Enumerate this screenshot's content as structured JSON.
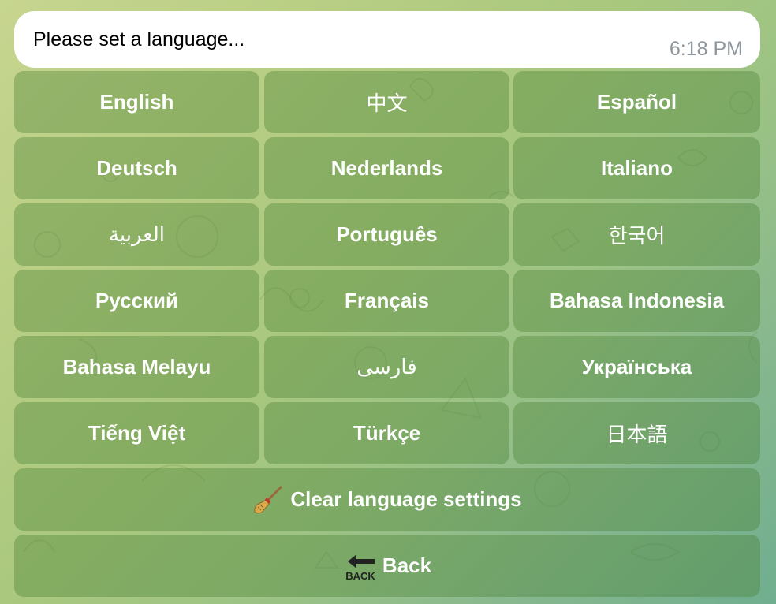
{
  "message": {
    "text": "Please set a language...",
    "time": "6:18 PM"
  },
  "keyboard": {
    "rows": [
      [
        "English",
        "中文",
        "Español"
      ],
      [
        "Deutsch",
        "Nederlands",
        "Italiano"
      ],
      [
        "العربية",
        "Português",
        "한국어"
      ],
      [
        "Русский",
        "Français",
        "Bahasa Indonesia"
      ],
      [
        "Bahasa Melayu",
        "فارسی",
        "Українська"
      ],
      [
        "Tiếng Việt",
        "Türkçe",
        "日本語"
      ]
    ],
    "clear_label": "Clear language settings",
    "back_label": "Back",
    "back_icon_text": "BACK"
  },
  "icons": {
    "clear": "broom-icon",
    "back": "back-arrow-icon"
  },
  "colors": {
    "button_fill": "#6f9e55",
    "message_bg": "#ffffff",
    "time_text": "#8e969c"
  }
}
